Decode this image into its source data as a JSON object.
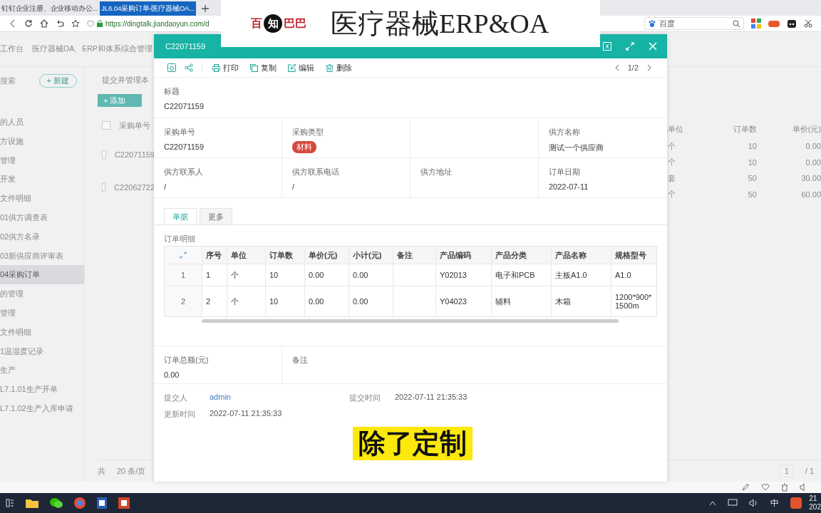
{
  "browser": {
    "tabs": [
      {
        "title": "钉钉企业注册、企业移动办公...",
        "selected": false
      },
      {
        "title": "JL6.04采购订单-医疗器械OA...",
        "selected": true
      }
    ],
    "url": "https://dingtalk.jiandaoyun.com/d",
    "search_placeholder": "百度"
  },
  "app": {
    "breadcrumb": [
      "工作台",
      "医疗器械OA、ERP和体系综合管理"
    ],
    "sidebar": {
      "search_placeholder": "搜索",
      "new_button": "+ 新建",
      "items": [
        {
          "label": "的人员",
          "selected": false
        },
        {
          "label": "方设施",
          "selected": false
        },
        {
          "label": "管理",
          "selected": false
        },
        {
          "label": "开发",
          "selected": false
        },
        {
          "label": "文件明细",
          "selected": false
        },
        {
          "label": "01供方调查表",
          "selected": false
        },
        {
          "label": "02供方名录",
          "selected": false
        },
        {
          "label": "03新供应商评审表",
          "selected": false
        },
        {
          "label": "04采购订单",
          "selected": true
        },
        {
          "label": "的管理",
          "selected": false
        },
        {
          "label": "管理",
          "selected": false
        },
        {
          "label": "文件明细",
          "selected": false
        },
        {
          "label": "1温湿度记录",
          "selected": false
        },
        {
          "label": "生产",
          "selected": false
        },
        {
          "label": "L7.1.01生产开单",
          "selected": false
        },
        {
          "label": "L7.1.02生产入库申请",
          "selected": false
        }
      ]
    },
    "form_tab": "提交并管理本",
    "add_button": "+ 添加",
    "list_left": {
      "column": "采购单号",
      "all_checked": false,
      "rows": [
        {
          "number": "C22071159",
          "checked": false
        },
        {
          "number": "C22062722",
          "checked": false
        }
      ]
    },
    "list_right": {
      "columns": [
        "单位",
        "订单数",
        "单价(元)"
      ],
      "rows": [
        [
          "个",
          "10",
          "0.00"
        ],
        [
          "个",
          "10",
          "0.00"
        ],
        [
          "套",
          "50",
          "30.00"
        ],
        [
          "个",
          "50",
          "60.00"
        ]
      ]
    },
    "footer": {
      "total": "共",
      "page_size": "20 条/页",
      "page": "1",
      "pages": "/ 1"
    }
  },
  "modal": {
    "title": "C22071159",
    "actions": [
      {
        "kind": "print",
        "label": "打印"
      },
      {
        "kind": "copy",
        "label": "复制"
      },
      {
        "kind": "edit",
        "label": "编辑"
      },
      {
        "kind": "delete",
        "label": "删除"
      }
    ],
    "pager": "1/2",
    "title_field": {
      "label": "标题",
      "value": "C22071159"
    },
    "fields": [
      {
        "kind": "text",
        "label": "采购单号",
        "value": "C22071159"
      },
      {
        "kind": "tag",
        "label": "采购类型",
        "value": "材料"
      },
      {
        "kind": "empty"
      },
      {
        "kind": "text",
        "label": "供方名称",
        "value": "测试一个供应商"
      },
      {
        "kind": "text",
        "label": "供方联系人",
        "value": "/"
      },
      {
        "kind": "text",
        "label": "供方联系电话",
        "value": "/"
      },
      {
        "kind": "text",
        "label": "供方地址"
      },
      {
        "kind": "text",
        "label": "订单日期",
        "value": "2022-07-11"
      }
    ],
    "tabs": [
      {
        "label": "单据",
        "selected": true
      },
      {
        "label": "更多",
        "selected": false
      }
    ],
    "detail": {
      "label": "订单明细",
      "columns": [
        "",
        "序号",
        "单位",
        "订单数",
        "单价(元)",
        "小计(元)",
        "备注",
        "产品编码",
        "产品分类",
        "产品名称",
        "规格型号"
      ],
      "rows": [
        [
          "1",
          "1",
          "个",
          "10",
          "0.00",
          "0.00",
          "",
          "Y02013",
          "电子和PCB",
          "主板A1.0",
          "A1.0"
        ],
        [
          "2",
          "2",
          "个",
          "10",
          "0.00",
          "0.00",
          "",
          "Y04023",
          "辅料",
          "木箱",
          "1200*900*1500m"
        ]
      ]
    },
    "summary": [
      {
        "label": "订单总额(元)",
        "value": "0.00"
      },
      {
        "label": "备注"
      }
    ],
    "meta": [
      {
        "kind": "link",
        "label": "提交人",
        "value": "admin"
      },
      {
        "kind": "text",
        "label": "提交时间",
        "value": "2022-07-11 21:35:33"
      },
      {
        "kind": "text",
        "label": "更新时间",
        "value": "2022-07-11 21:35:33"
      }
    ]
  },
  "overlay": {
    "logo": [
      "百",
      "知",
      "巴巴"
    ],
    "title": "医疗器械ERP&OA",
    "caption": "除了定制"
  },
  "taskbar": {
    "ime": "中",
    "clock": [
      "21",
      "202"
    ]
  }
}
